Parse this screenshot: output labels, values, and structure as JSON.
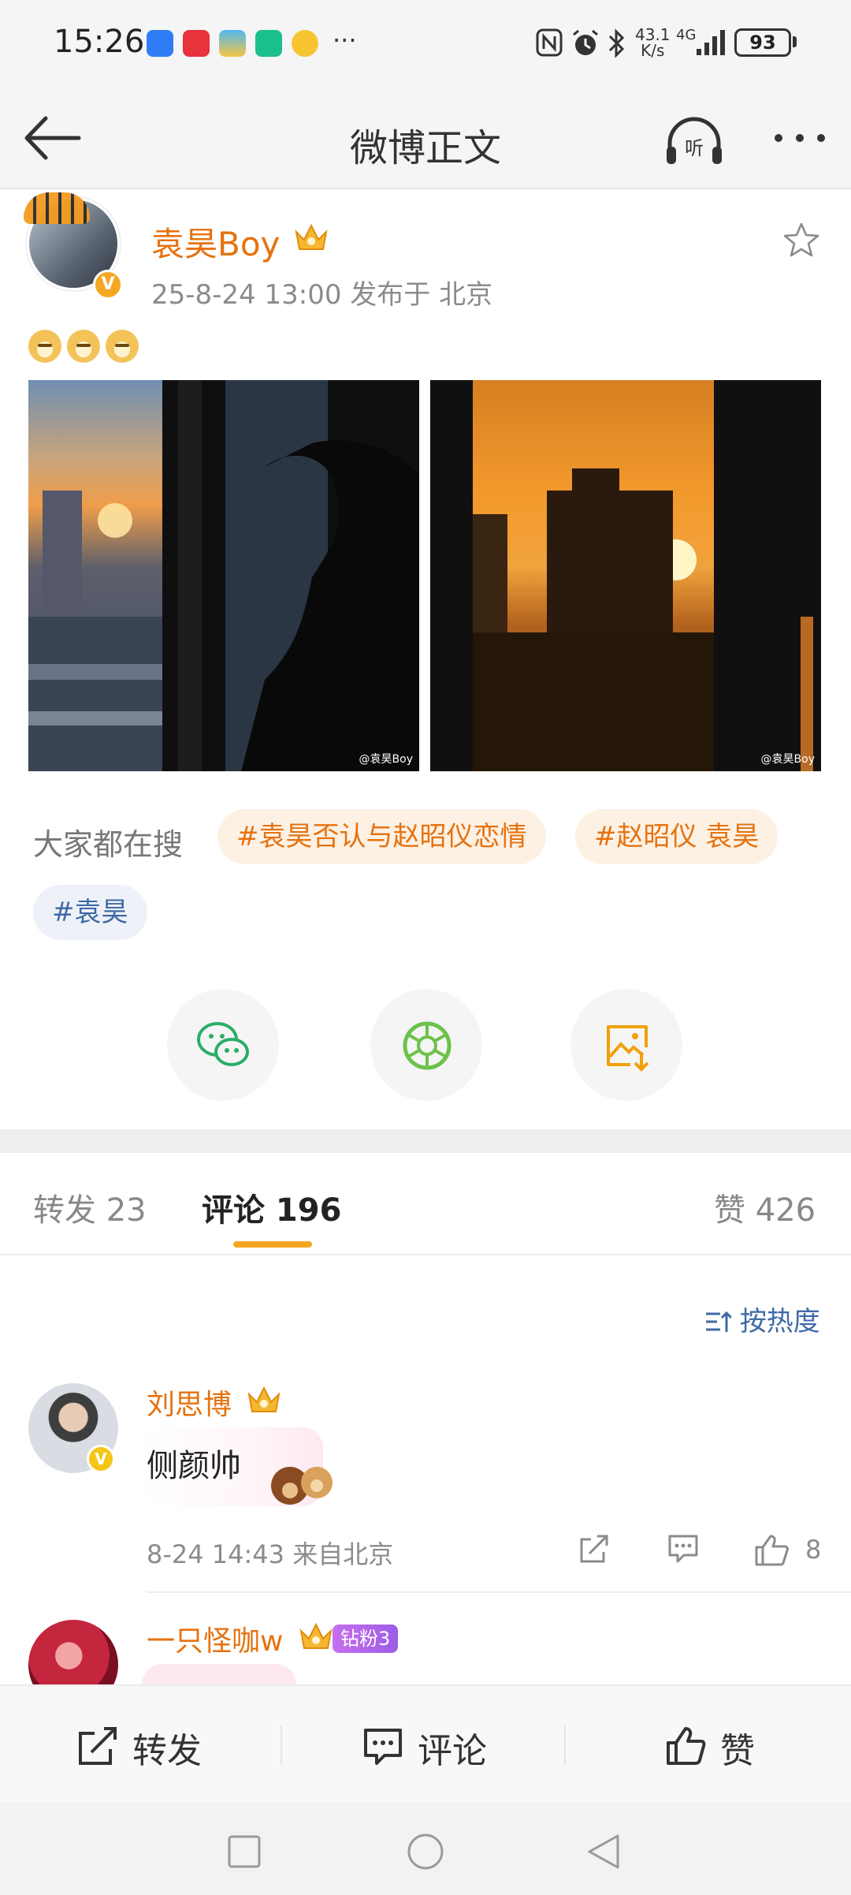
{
  "status_bar": {
    "time": "15:26",
    "more_indicator": "···",
    "net_speed": "43.1",
    "net_speed_unit": "K/s",
    "net_type": "4G",
    "battery": "93"
  },
  "nav": {
    "title": "微博正文",
    "listen_label": "听"
  },
  "post": {
    "username": "袁昊Boy",
    "meta": "25-8-24 13:00  发布于 北京",
    "verified_mark": "V",
    "emoji": [
      "doge",
      "doge",
      "doge"
    ],
    "watermark_1": "@袁昊Boy",
    "watermark_2": "@袁昊Boy"
  },
  "search": {
    "label": "大家都在搜",
    "tags": [
      "#袁昊否认与赵昭仪恋情",
      "#赵昭仪 袁昊",
      "#袁昊"
    ]
  },
  "tabs": {
    "repost": "转发 23",
    "comments": "评论 196",
    "likes": "赞 426"
  },
  "sort_label": "按热度",
  "comments": [
    {
      "name": "刘思博",
      "text": "侧颜帅",
      "meta": "8-24 14:43  来自北京",
      "likes": "8",
      "verified_mark": "V"
    },
    {
      "name": "一只怪咖w",
      "badge": "钻粉3"
    }
  ],
  "actions": {
    "repost": "转发",
    "comment": "评论",
    "like": "赞"
  },
  "colors": {
    "accent_orange": "#e6720f",
    "tab_underline": "#f5a623",
    "link_blue": "#3f6aa6",
    "wechat_green": "#2aae67"
  }
}
